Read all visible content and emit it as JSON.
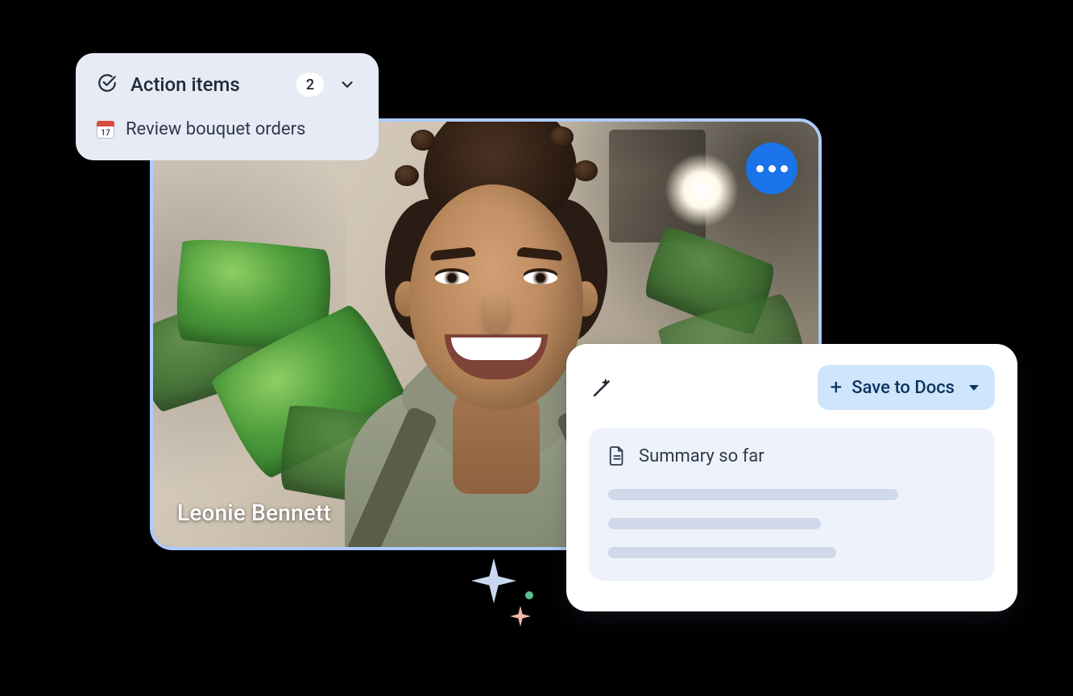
{
  "video": {
    "participant_name": "Leonie Bennett"
  },
  "action_items": {
    "title": "Action items",
    "count": "2",
    "items": [
      {
        "label": "Review bouquet orders"
      }
    ]
  },
  "summary": {
    "save_button_label": "Save to Docs",
    "section_title": "Summary so far"
  },
  "colors": {
    "video_border": "#aeccff",
    "more_button": "#1a73e8",
    "action_card_bg": "#e6ebf5",
    "save_button_bg": "#cfe5fb",
    "summary_body_bg": "#eef2fa",
    "skeleton": "#cfd9ea"
  }
}
